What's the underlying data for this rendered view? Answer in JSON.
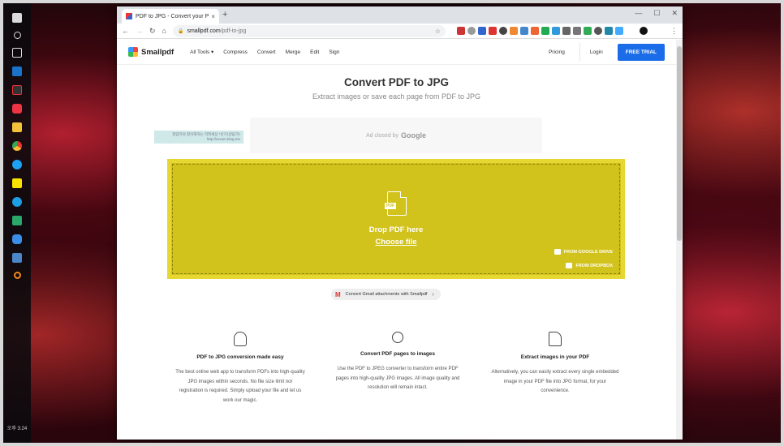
{
  "taskbar": {
    "clock": "오후 3:24",
    "icons": [
      "windows-start-icon",
      "search-icon",
      "task-view-icon",
      "outlook-icon",
      "app-icon",
      "app-icon",
      "file-explorer-icon",
      "chrome-icon",
      "twitter-icon",
      "kakaotalk-icon",
      "internet-explorer-icon",
      "app-icon",
      "cloud-icon",
      "app-icon",
      "search-app-icon"
    ]
  },
  "browser": {
    "tab_title": "PDF to JPG - Convert your PDF t",
    "tab_close": "×",
    "new_tab": "+",
    "url_host": "smallpdf.com",
    "url_path": "/pdf-to-jpg",
    "window_controls": {
      "minimize": "—",
      "maximize": "☐",
      "close": "✕"
    }
  },
  "nav": {
    "logo": "Smallpdf",
    "links": [
      "All Tools ▾",
      "Compress",
      "Convert",
      "Merge",
      "Edit",
      "Sign"
    ],
    "pricing": "Pricing",
    "login": "Login",
    "trial": "FREE TRIAL"
  },
  "hero": {
    "title": "Convert PDF to JPG",
    "subtitle": "Extract images or save each page from PDF to JPG"
  },
  "ad": {
    "left_text_1": "창업자의 창이해하는 리퍼세상 *인기/상팀/가!",
    "left_text_2": "http://xxxxm.blog.me",
    "closed_by": "Ad closed by",
    "google": "Google"
  },
  "dropzone": {
    "pdf_tag": "PDF",
    "drop_text": "Drop PDF here",
    "choose_file": "Choose file",
    "google_drive": "FROM GOOGLE DRIVE",
    "dropbox": "FROM DROPBOX"
  },
  "gmail": {
    "icon": "M",
    "label": "Convert Gmail attachments with Smallpdf",
    "chevron": "›"
  },
  "features": [
    {
      "title": "PDF to JPG conversion made easy",
      "body": "The best online web app to transform PDFs into high-quality JPG images within seconds. No file size limit nor registration is required. Simply upload your file and let us work our magic."
    },
    {
      "title": "Convert PDF pages to images",
      "body": "Use the PDF to JPEG converter to transform entire PDF pages into high-quality JPG images. All image quality and resolution will remain intact."
    },
    {
      "title": "Extract images in your PDF",
      "body": "Alternatively, you can easily extract every single embedded image in your PDF file into JPG format, for your convenience."
    }
  ],
  "colors": {
    "dropzone": "#d1c21c",
    "trial_button": "#1a6ce8"
  }
}
